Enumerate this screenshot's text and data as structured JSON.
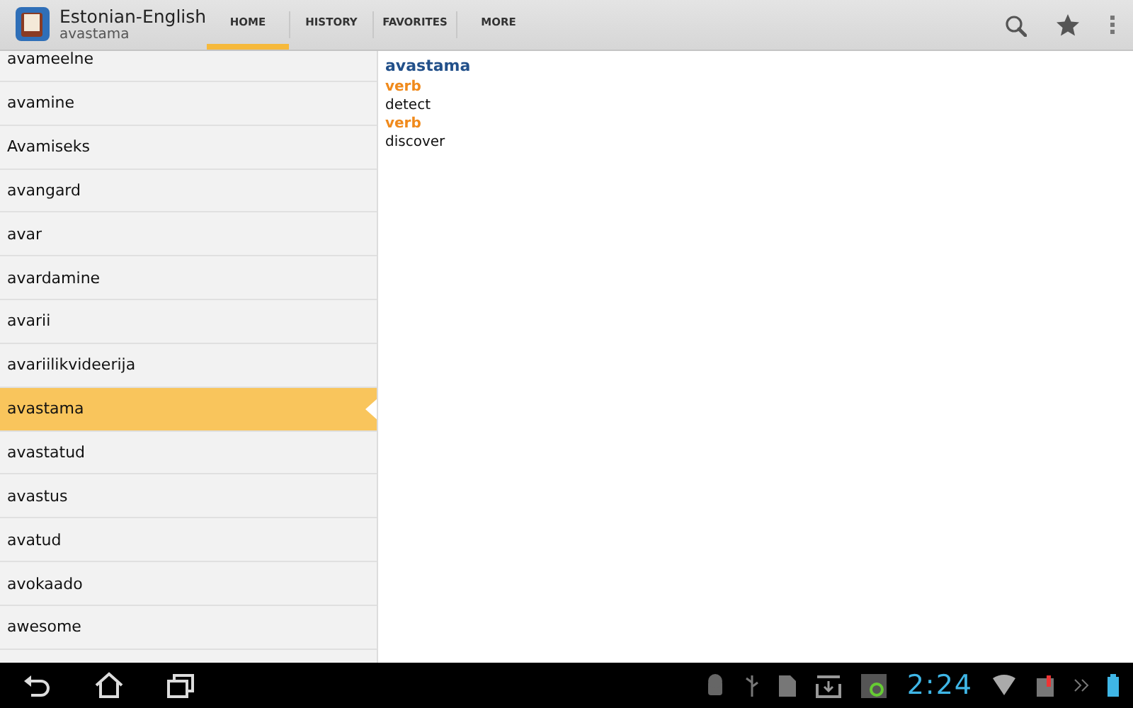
{
  "app_bar": {
    "title": "Estonian-English",
    "subtitle": "avastama"
  },
  "tabs": [
    {
      "label": "HOME",
      "selected": true
    },
    {
      "label": "HISTORY",
      "selected": false
    },
    {
      "label": "FAVORITES",
      "selected": false
    },
    {
      "label": "MORE",
      "selected": false
    }
  ],
  "word_list": [
    {
      "word": "avameelne",
      "selected": false
    },
    {
      "word": "avamine",
      "selected": false
    },
    {
      "word": "Avamiseks",
      "selected": false
    },
    {
      "word": "avangard",
      "selected": false
    },
    {
      "word": "avar",
      "selected": false
    },
    {
      "word": "avardamine",
      "selected": false
    },
    {
      "word": "avarii",
      "selected": false
    },
    {
      "word": "avariilikvideerija",
      "selected": false
    },
    {
      "word": "avastama",
      "selected": true
    },
    {
      "word": "avastatud",
      "selected": false
    },
    {
      "word": "avastus",
      "selected": false
    },
    {
      "word": "avatud",
      "selected": false
    },
    {
      "word": "avokaado",
      "selected": false
    },
    {
      "word": "awesome",
      "selected": false
    }
  ],
  "entry": {
    "headword": "avastama",
    "senses": [
      {
        "pos": "verb",
        "translation": "detect"
      },
      {
        "pos": "verb",
        "translation": "discover"
      }
    ]
  },
  "status_bar": {
    "time": "2:24"
  }
}
